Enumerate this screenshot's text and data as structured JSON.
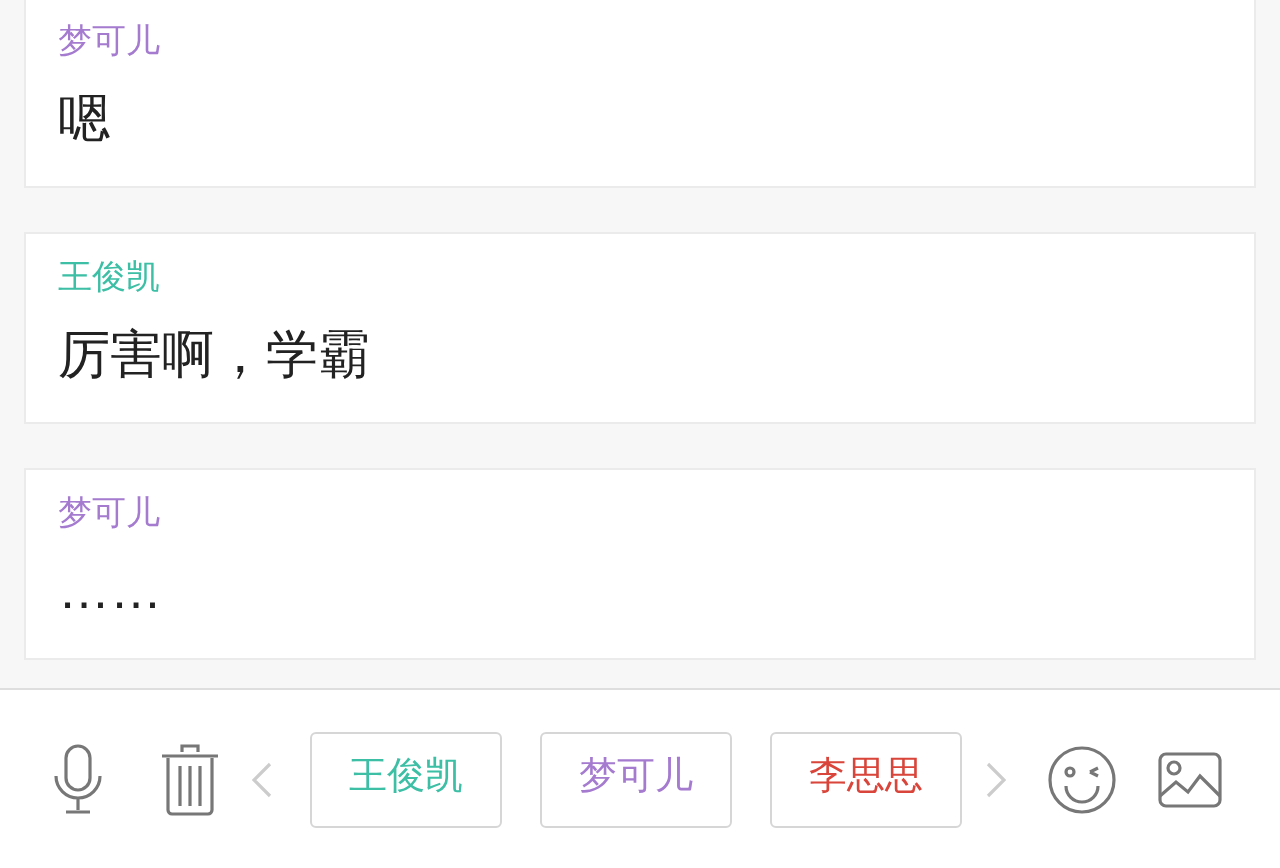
{
  "messages": [
    {
      "sender": "梦可儿",
      "color": "#a57bd0",
      "text": "嗯"
    },
    {
      "sender": "王俊凯",
      "color": "#3dbfa6",
      "text": "厉害啊，学霸"
    },
    {
      "sender": "梦可儿",
      "color": "#a57bd0",
      "text": "……"
    }
  ],
  "speakers": [
    {
      "label": "王俊凯",
      "color": "#3dbfa6"
    },
    {
      "label": "梦可儿",
      "color": "#a57bd0"
    },
    {
      "label": "李思思",
      "color": "#d9453a"
    }
  ]
}
